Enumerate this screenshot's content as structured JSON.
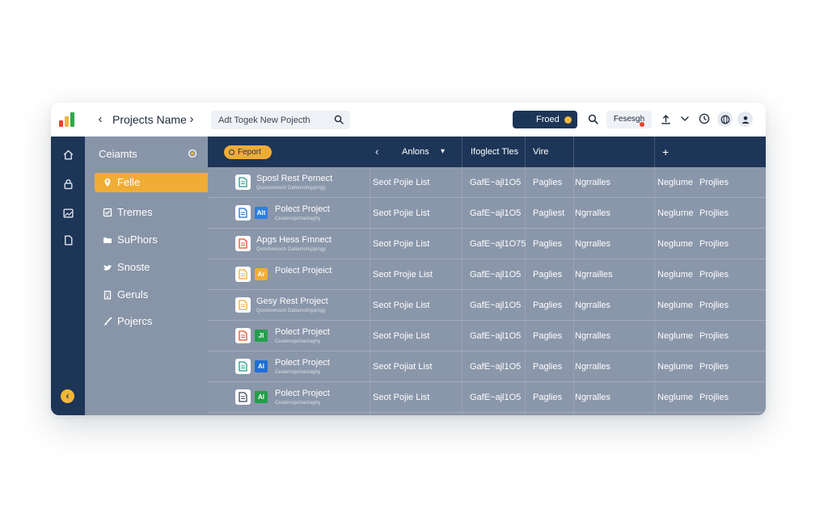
{
  "header": {
    "title": "Projects Name",
    "search_placeholder": "Adt Togek New Pojecth",
    "found_label": "Froed",
    "research_label": "Fesesgh"
  },
  "sidebar": {
    "heading": "Ceiamts",
    "items": [
      {
        "label": "Felle",
        "icon": "pin-icon",
        "active": true
      },
      {
        "label": "Tremes",
        "icon": "checkbox-icon",
        "active": false
      },
      {
        "label": "SuPhors",
        "icon": "folder-icon",
        "active": false
      },
      {
        "label": "Snoste",
        "icon": "bird-icon",
        "active": false
      },
      {
        "label": "Geruls",
        "icon": "building-icon",
        "active": false
      },
      {
        "label": "Pojercs",
        "icon": "brush-icon",
        "active": false
      }
    ]
  },
  "table": {
    "report_label": "Feport",
    "columns": [
      "Anlons",
      "Ifoglect Tles",
      "Vire"
    ],
    "plus_label": "+",
    "rows": [
      {
        "name": "Sposl Rest Pernect",
        "sub": "Quisitvenoch Dallamshippingy",
        "badge": "",
        "badge_color": "",
        "doc_color": "#1c9b8a",
        "c1": "Seot Pojie List",
        "c2": "GafE~ajl1O5",
        "c3": "Paglies",
        "c4": "Ngrralles",
        "c5": "Neglume",
        "c6": "Projlies"
      },
      {
        "name": "Polect Project",
        "sub": "Cealenopshaolaghy",
        "badge": "Alt",
        "badge_color": "#2e7de1",
        "doc_color": "#1e6fd9",
        "c1": "Seot Pojie List",
        "c2": "GafE~ajl1O5",
        "c3": "Pagliest",
        "c4": "Ngrralles",
        "c5": "Neglurne",
        "c6": "Projlies"
      },
      {
        "name": "Apgs Hess Fmnect",
        "sub": "Quisitvenoch Dallamshippingy",
        "badge": "",
        "badge_color": "",
        "doc_color": "#e0502b",
        "c1": "Seot Pojie List",
        "c2": "GafE~ajl1O75",
        "c3": "Paglies",
        "c4": "Ngrralles",
        "c5": "Neglume",
        "c6": "Projlies"
      },
      {
        "name": "Polect Projeict",
        "sub": "",
        "badge": "Ar",
        "badge_color": "#f0ad35",
        "doc_color": "#f0ad35",
        "c1": "Seot Projie List",
        "c2": "GafE~ajl1O5",
        "c3": "Paglies",
        "c4": "Ngrrailles",
        "c5": "Neglume",
        "c6": "Projlies"
      },
      {
        "name": "Gesy Rest Project",
        "sub": "Quisitvenoch Dallamshippingy",
        "badge": "",
        "badge_color": "",
        "doc_color": "#f0ad35",
        "c1": "Seot Pojie List",
        "c2": "GafE~ajl1O5",
        "c3": "Paglies",
        "c4": "Ngrralles",
        "c5": "Neglume",
        "c6": "Projlies"
      },
      {
        "name": "Polect Project",
        "sub": "Cealenopshaolaghy",
        "badge": "Jl",
        "badge_color": "#22a04b",
        "doc_color": "#e0502b",
        "c1": "Seot Pojie List",
        "c2": "GafE~ajl1O5",
        "c3": "Paglies",
        "c4": "Ngrralles",
        "c5": "Neglume",
        "c6": "Projlies"
      },
      {
        "name": "Polect Project",
        "sub": "Cealenopshaolaghy",
        "badge": "Al",
        "badge_color": "#1e6fd9",
        "doc_color": "#1c9b8a",
        "c1": "Seot Pojiat List",
        "c2": "GafE~ajl1O5",
        "c3": "Paglies",
        "c4": "Ngrralles",
        "c5": "Neglume",
        "c6": "Projlies"
      },
      {
        "name": "Polect Project",
        "sub": "Cealenopshaolaghy",
        "badge": "Al",
        "badge_color": "#22a04b",
        "doc_color": "#3b4656",
        "c1": "Seot Pojie List",
        "c2": "GafE~ajl1O5",
        "c3": "Paglies",
        "c4": "Ngrralles",
        "c5": "Neglume",
        "c6": "Projlies"
      }
    ]
  },
  "colors": {
    "navy": "#1d3557",
    "accent": "#f0ad35",
    "panel": "#8894a8",
    "table": "#8a96aa"
  }
}
